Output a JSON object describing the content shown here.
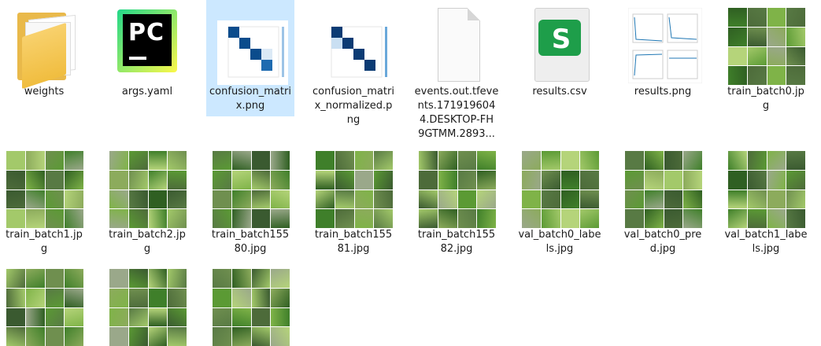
{
  "files": [
    {
      "label": "weights",
      "kind": "folder"
    },
    {
      "label": "args.yaml",
      "kind": "pycharm"
    },
    {
      "label": "confusion_matri\nx.png",
      "kind": "matrix",
      "selected": true
    },
    {
      "label": "confusion_matri\nx_normalized.p\nng",
      "kind": "matrix"
    },
    {
      "label": "events.out.tfeve\nnts.171919604\n4.DESKTOP-FH\n9GTMM.2893...",
      "kind": "blank"
    },
    {
      "label": "results.csv",
      "kind": "csv"
    },
    {
      "label": "results.png",
      "kind": "plot"
    },
    {
      "label": "train_batch0.jp\ng",
      "kind": "photo"
    },
    {
      "label": "train_batch1.jp\ng",
      "kind": "photo"
    },
    {
      "label": "train_batch2.jp\ng",
      "kind": "photo"
    },
    {
      "label": "train_batch155\n80.jpg",
      "kind": "photo"
    },
    {
      "label": "train_batch155\n81.jpg",
      "kind": "photo"
    },
    {
      "label": "train_batch155\n82.jpg",
      "kind": "photo"
    },
    {
      "label": "val_batch0_labe\nls.jpg",
      "kind": "photo"
    },
    {
      "label": "val_batch0_pre\nd.jpg",
      "kind": "photo"
    },
    {
      "label": "val_batch1_labe\nls.jpg",
      "kind": "photo"
    },
    {
      "label": "",
      "kind": "photo"
    },
    {
      "label": "",
      "kind": "photo"
    },
    {
      "label": "",
      "kind": "photo"
    }
  ],
  "icons": {
    "folder": "folder-icon",
    "pycharm": "pycharm-file-icon",
    "matrix": "image-thumbnail",
    "blank": "generic-file-icon",
    "csv": "spreadsheet-file-icon",
    "plot": "image-thumbnail",
    "photo": "image-thumbnail"
  },
  "pycharm_text": "PC",
  "csv_letter": "S",
  "colors": {
    "selection": "#cce8ff",
    "csv_green": "#1e9e4a",
    "folder_yellow": "#f0bd3f",
    "matrix_blue": "#0b4c8c"
  }
}
